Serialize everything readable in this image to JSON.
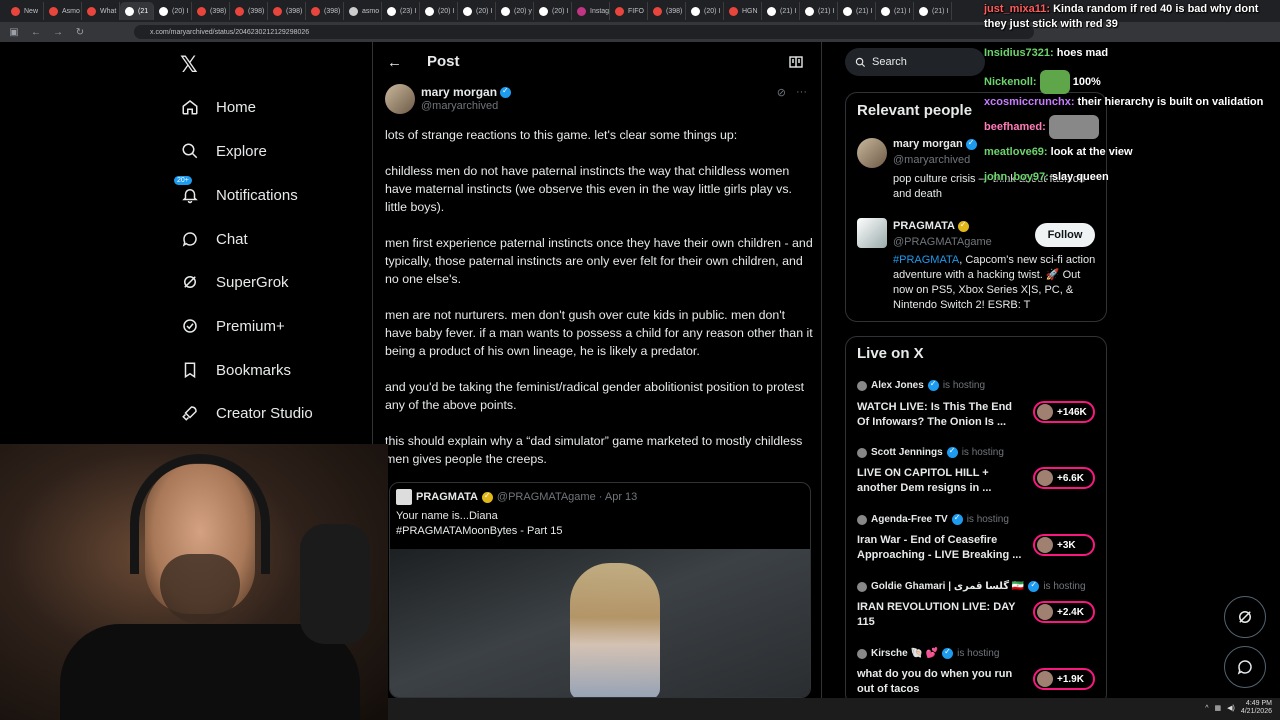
{
  "browser": {
    "tabs": [
      "New",
      "Asmo",
      "What",
      "(21",
      "(20) I",
      "(398)",
      "(398)",
      "(398)",
      "(398)",
      "asmo",
      "(23) I",
      "(20) I",
      "(20) I",
      "(20) y",
      "(20) I",
      "Instag",
      "FIFO",
      "(398)",
      "(20) I",
      "HGN",
      "(21) I",
      "(21) I",
      "(21) I",
      "(21) I",
      "(21) I"
    ],
    "url": "x.com/maryarchived/status/2046230212129298026"
  },
  "nav": {
    "items": [
      {
        "label": "Home",
        "icon": "home-icon"
      },
      {
        "label": "Explore",
        "icon": "search-icon"
      },
      {
        "label": "Notifications",
        "icon": "bell-icon",
        "badge": "20+"
      },
      {
        "label": "Chat",
        "icon": "chat-icon"
      },
      {
        "label": "SuperGrok",
        "icon": "grok-icon"
      },
      {
        "label": "Premium+",
        "icon": "verified-icon"
      },
      {
        "label": "Bookmarks",
        "icon": "bookmark-icon"
      },
      {
        "label": "Creator Studio",
        "icon": "rocket-icon"
      }
    ]
  },
  "post": {
    "header_title": "Post",
    "author_name": "mary morgan",
    "author_handle": "@maryarchived",
    "paragraphs": [
      "lots of strange reactions to this game. let's clear some things up:",
      "childless men do not have paternal instincts the way that childless women have maternal instincts (we observe this even in the way little girls play vs. little boys).",
      "men first experience paternal instincts once they have their own children - and typically, those paternal instincts are only ever felt for their own children, and no one else's.",
      "men are not nurturers. men don't gush over cute kids in public. men don't have baby fever. if a man wants to possess a child for any reason other than it being a product of his own lineage, he is likely a predator.",
      "and you'd be taking the feminist/radical gender abolitionist position to protest any of the above points.",
      "this should explain why a “dad simulator” game marketed to mostly childless men gives people the creeps."
    ],
    "quote": {
      "name": "PRAGMATA",
      "meta": "@PRAGMATAgame · Apr 13",
      "text_line1": "Your name is...Diana",
      "text_line2": "#PRAGMATAMoonBytes - Part 15"
    }
  },
  "sidebar": {
    "search_placeholder": "Search",
    "relevant_title": "Relevant people",
    "people": [
      {
        "name": "mary morgan",
        "handle": "@maryarchived",
        "bio": "pop culture crisis — think about fashion and death"
      },
      {
        "name": "PRAGMATA",
        "handle": "@PRAGMATAgame",
        "bio_tag": "#PRAGMATA",
        "bio": ", Capcom's new sci-fi action adventure with a hacking twist. 🚀 Out now on PS5, Xbox Series X|S, PC, & Nintendo Switch 2! ESRB: T",
        "follow": "Follow"
      }
    ],
    "live_title": "Live on X",
    "hosting_label": "is hosting",
    "live": [
      {
        "host": "Alex Jones",
        "title": "WATCH LIVE: Is This The End Of Infowars? The Onion Is ...",
        "count": "+146K"
      },
      {
        "host": "Scott Jennings",
        "title": "LIVE ON CAPITOL HILL + another Dem resigns in ...",
        "count": "+6.6K"
      },
      {
        "host": "Agenda-Free TV",
        "title": "Iran War - End of Ceasefire Approaching - LIVE Breaking ...",
        "count": "+3K"
      },
      {
        "host": "Goldie Ghamari | گلسا قمری 🇮🇷",
        "title": "IRAN REVOLUTION LIVE: DAY 115",
        "count": "+2.4K"
      },
      {
        "host": "Kirsche 🐚 💕",
        "title": "what do you do when you run out of tacos",
        "count": "+1.9K"
      }
    ]
  },
  "chat": [
    {
      "user": "just_mixa11:",
      "msg": "Kinda random if red 40 is bad why dont they just stick with red 39",
      "color": "red"
    },
    {
      "user": "Insidius7321:",
      "msg": "hoes mad",
      "color": "green"
    },
    {
      "user": "Nickenoll:",
      "msg": "100%",
      "color": "green"
    },
    {
      "user": "xcosmiccrunchx:",
      "msg": "their hierarchy is built on validation",
      "color": "purple"
    },
    {
      "user": "beefhamed:",
      "msg": "",
      "color": "pink"
    },
    {
      "user": "meatlove69:",
      "msg": "look at the view",
      "color": "green"
    },
    {
      "user": "john_boy97:",
      "msg": "slay queen",
      "color": "green"
    }
  ],
  "taskbar": {
    "time": "4:49 PM",
    "date": "4/21/2026"
  }
}
